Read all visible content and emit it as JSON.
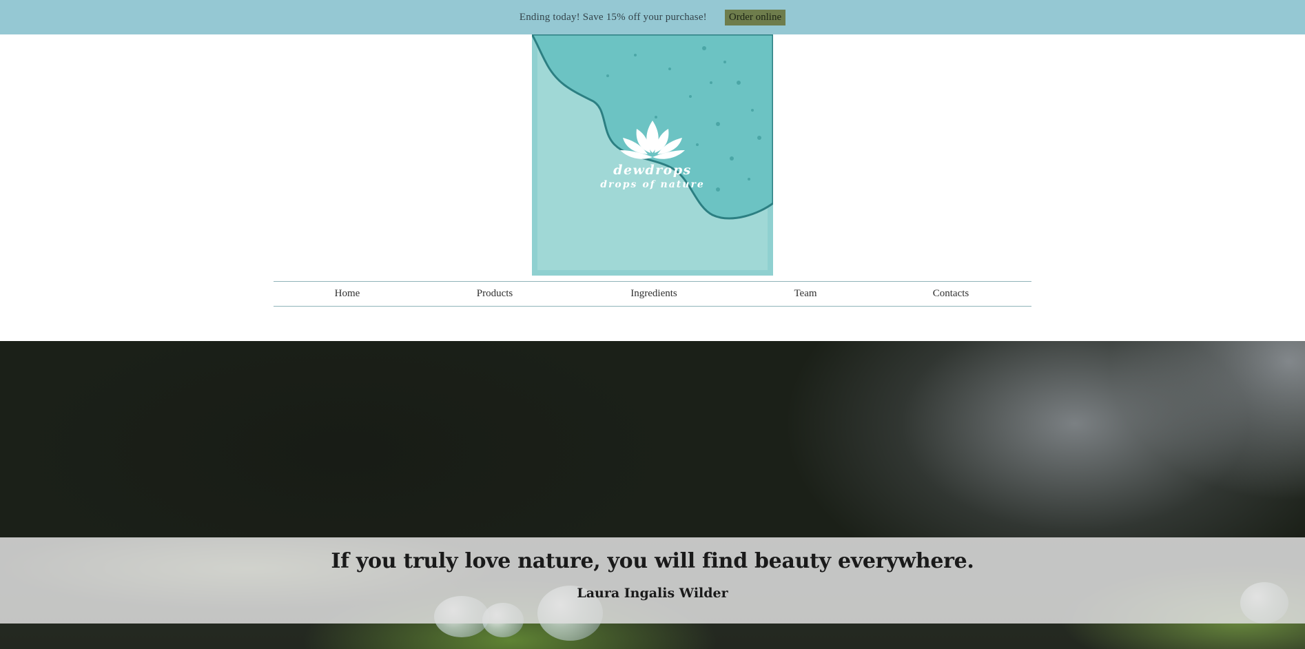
{
  "promo": {
    "text": "Ending today! Save 15% off your purchase!",
    "button_label": "Order online",
    "bg_color": "#95c8d3",
    "button_color": "#6e7d4c"
  },
  "logo": {
    "name": "dewdrops",
    "tagline": "drops of nature",
    "icon": "lotus-icon",
    "bg_color": "#8fd0d0"
  },
  "nav": {
    "items": [
      {
        "label": "Home"
      },
      {
        "label": "Products"
      },
      {
        "label": "Ingredients"
      },
      {
        "label": "Team"
      },
      {
        "label": "Contacts"
      }
    ]
  },
  "hero": {
    "quote": "If you truly love nature, you will find beauty everywhere.",
    "author": "Laura Ingalis Wilder"
  }
}
